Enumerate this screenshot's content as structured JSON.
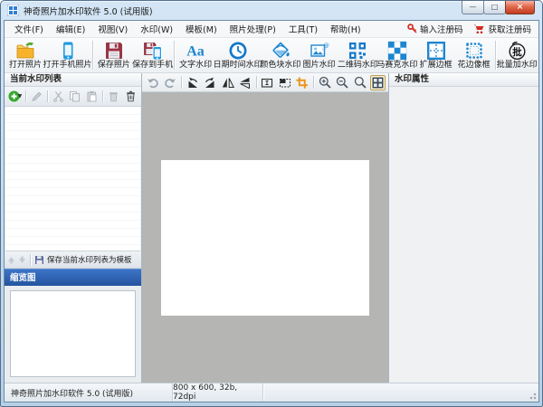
{
  "window": {
    "title": "神奇照片加水印软件 5.0 (试用版)",
    "icon": "app-grid-icon",
    "controls": {
      "minimize": "—",
      "maximize": "□",
      "close": "×"
    }
  },
  "menu_bar": {
    "items": [
      {
        "label": "文件(F)"
      },
      {
        "label": "编辑(E)"
      },
      {
        "label": "视图(V)"
      },
      {
        "label": "水印(W)"
      },
      {
        "label": "模板(M)"
      },
      {
        "label": "照片处理(P)"
      },
      {
        "label": "工具(T)"
      },
      {
        "label": "帮助(H)"
      }
    ],
    "register_input": {
      "label": "输入注册码",
      "icon": "key-icon"
    },
    "register_get": {
      "label": "获取注册码",
      "icon": "cart-icon"
    }
  },
  "toolbar": {
    "buttons": [
      {
        "label": "打开照片",
        "icon": "open-photo-icon"
      },
      {
        "label": "打开手机照片",
        "icon": "open-phone-photo-icon"
      },
      {
        "label": "保存照片",
        "icon": "save-photo-icon"
      },
      {
        "label": "保存到手机",
        "icon": "save-to-phone-icon"
      },
      {
        "label": "文字水印",
        "icon": "text-watermark-icon"
      },
      {
        "label": "日期时间水印",
        "icon": "datetime-watermark-icon"
      },
      {
        "label": "颜色块水印",
        "icon": "color-block-watermark-icon"
      },
      {
        "label": "图片水印",
        "icon": "image-watermark-icon"
      },
      {
        "label": "二维码水印",
        "icon": "qrcode-watermark-icon"
      },
      {
        "label": "马赛克水印",
        "icon": "mosaic-watermark-icon"
      },
      {
        "label": "扩展边框",
        "icon": "extend-border-icon"
      },
      {
        "label": "花边像框",
        "icon": "lace-frame-icon"
      },
      {
        "label": "批量加水印",
        "icon": "batch-watermark-icon"
      }
    ]
  },
  "edit_toolbar": {
    "tools": [
      "undo",
      "redo",
      "rotate-left",
      "rotate-right",
      "flip-horizontal",
      "flip-vertical",
      "resize",
      "canvas-size",
      "crop",
      "zoom-in",
      "zoom-out",
      "zoom-actual-size",
      "fit-to-window"
    ],
    "active_tool": "fit-to-window"
  },
  "left_panel": {
    "header": "当前水印列表",
    "tools": [
      "add-watermark",
      "edit-watermark",
      "cut",
      "copy",
      "paste",
      "delete",
      "delete-all"
    ],
    "move_up": "up-arrow",
    "move_down": "down-arrow",
    "save_template_label": "保存当前水印列表为模板",
    "thumbnail_header": "缩览图"
  },
  "right_panel": {
    "header": "水印属性"
  },
  "status_bar": {
    "app_name": "神奇照片加水印软件 5.0 (试用版)",
    "image_info": "800 x 600, 32b, 72dpi"
  },
  "colors": {
    "accent_blue": "#1e86d0",
    "register_red": "#d42b1f",
    "crop_orange": "#e8971e",
    "canvas_gray": "#b5b6b4",
    "thumbnail_header_blue": "#2a5db4",
    "floppy_maroon": "#9e3344",
    "open_arrow_green": "#57aa2e",
    "phone_blue": "#1f9ae0"
  }
}
